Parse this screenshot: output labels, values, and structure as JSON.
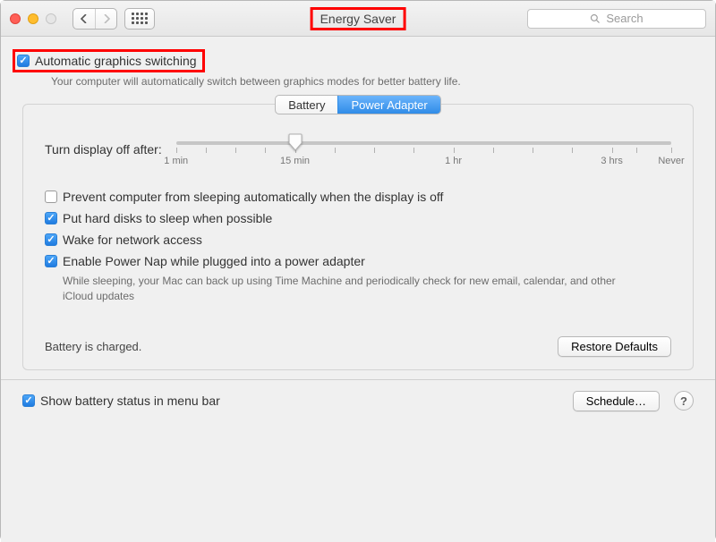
{
  "window": {
    "title": "Energy Saver"
  },
  "search": {
    "placeholder": "Search"
  },
  "automaticGraphics": {
    "label": "Automatic graphics switching",
    "checked": true,
    "description": "Your computer will automatically switch between graphics modes for better battery life."
  },
  "tabs": {
    "battery": "Battery",
    "powerAdapter": "Power Adapter",
    "selected": "powerAdapter"
  },
  "slider": {
    "label": "Turn display off after:",
    "ticks": {
      "min1": "1 min",
      "min15": "15 min",
      "hr1": "1 hr",
      "hr3": "3 hrs",
      "never": "Never"
    },
    "valuePercent": 24
  },
  "options": {
    "preventSleep": {
      "label": "Prevent computer from sleeping automatically when the display is off",
      "checked": false
    },
    "hardDisksSleep": {
      "label": "Put hard disks to sleep when possible",
      "checked": true
    },
    "wakeNetwork": {
      "label": "Wake for network access",
      "checked": true
    },
    "powerNap": {
      "label": "Enable Power Nap while plugged into a power adapter",
      "checked": true,
      "description": "While sleeping, your Mac can back up using Time Machine and periodically check for new email, calendar, and other iCloud updates"
    }
  },
  "status": "Battery is charged.",
  "buttons": {
    "restoreDefaults": "Restore Defaults",
    "schedule": "Schedule…"
  },
  "footer": {
    "showBatteryStatus": {
      "label": "Show battery status in menu bar",
      "checked": true
    }
  }
}
